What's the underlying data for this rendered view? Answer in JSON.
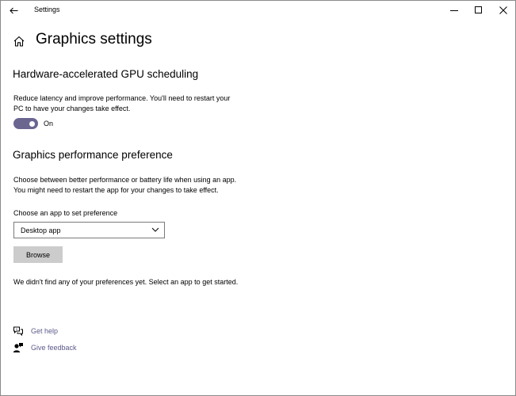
{
  "window": {
    "title": "Settings"
  },
  "header": {
    "title": "Graphics settings"
  },
  "gpu_scheduling": {
    "title": "Hardware-accelerated GPU scheduling",
    "description_lines": [
      "Reduce latency and improve performance. You'll need to restart your",
      "PC to have your changes take effect."
    ],
    "toggle_state": "On",
    "toggle_on": true,
    "toggle_color": "#6b6690"
  },
  "performance_pref": {
    "title": "Graphics performance preference",
    "description_lines": [
      "Choose between better performance or battery life when using an app.",
      "You might need to restart the app for your changes to take effect."
    ],
    "app_select_label": "Choose an app to set preference",
    "app_select_value": "Desktop app",
    "browse_label": "Browse",
    "empty_message": "We didn't find any of your preferences yet. Select an app to get started."
  },
  "links": {
    "get_help": "Get help",
    "give_feedback": "Give feedback",
    "link_color": "#5c5a8c"
  },
  "icons": {
    "back": "back-arrow-icon",
    "home": "home-icon",
    "minimize": "minimize-icon",
    "maximize": "maximize-icon",
    "close": "close-icon",
    "chevron": "chevron-down-icon",
    "help": "help-chat-icon",
    "feedback": "feedback-person-icon"
  }
}
